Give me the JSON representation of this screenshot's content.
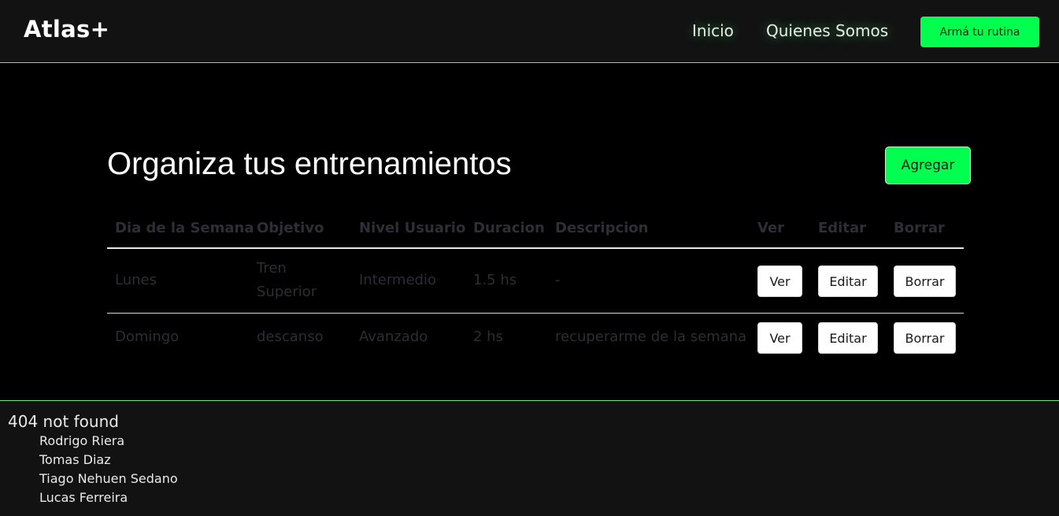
{
  "navbar": {
    "brand": "Atlas+",
    "links": [
      "Inicio",
      "Quienes Somos"
    ],
    "cta_label": "Armá tu rutina"
  },
  "main": {
    "title": "Organiza tus entrenamientos",
    "add_label": "Agregar",
    "table": {
      "headers": [
        "Dia de la Semana",
        "Objetivo",
        "Nivel Usuario",
        "Duracion",
        "Descripcion",
        "Ver",
        "Editar",
        "Borrar"
      ],
      "rows": [
        {
          "dia": "Lunes",
          "objetivo_line1": "Tren",
          "objetivo_line2": "Superior",
          "nivel": "Intermedio",
          "duracion": "1.5 hs",
          "descripcion": "-",
          "ver": "Ver",
          "editar": "Editar",
          "borrar": "Borrar"
        },
        {
          "dia": "Domingo",
          "objetivo": "descanso",
          "nivel": "Avanzado",
          "duracion": "2 hs",
          "descripcion": "recuperarme de la semana",
          "ver": "Ver",
          "editar": "Editar",
          "borrar": "Borrar"
        }
      ]
    }
  },
  "footer": {
    "title": "404 not found",
    "authors": [
      "Rodrigo Riera",
      "Tomas Diaz",
      "Tiago Nehuen Sedano",
      "Lucas Ferreira"
    ]
  },
  "colors": {
    "accent": "#00ff4f",
    "navbar_bg": "#121212",
    "border_accent": "#7fdc8a"
  }
}
